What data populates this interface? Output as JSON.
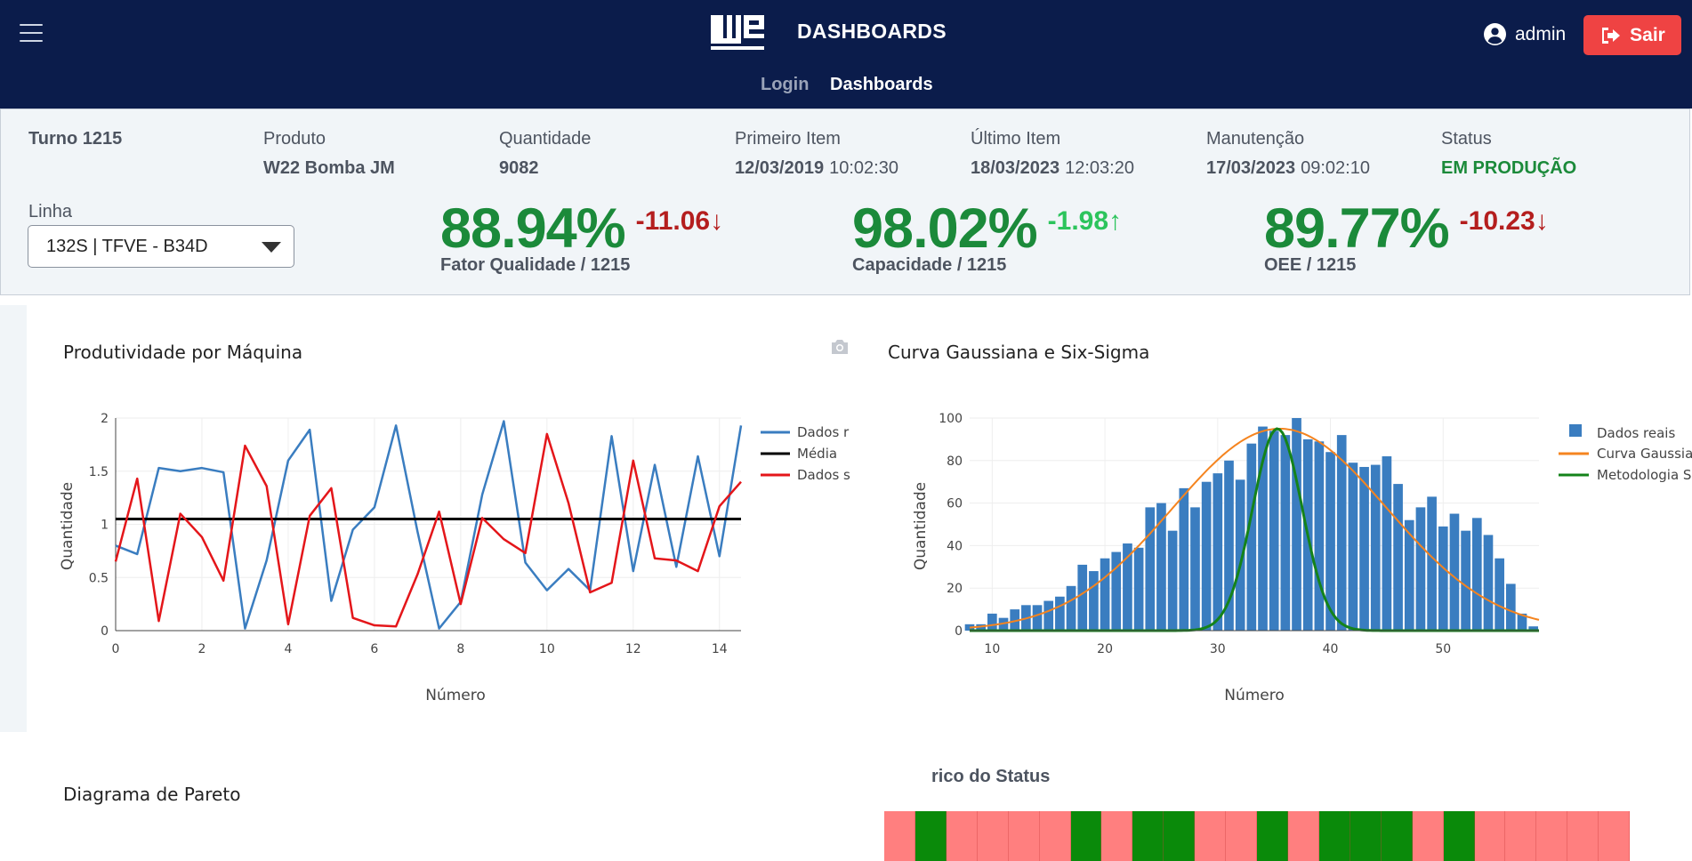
{
  "header": {
    "logo_text": "WEG",
    "title": "DASHBOARDS",
    "nav": {
      "login": "Login",
      "dashboards": "Dashboards"
    },
    "user": "admin",
    "logout": "Sair",
    "bg_color": "#0b1c4b"
  },
  "info": {
    "turno": "Turno 1215",
    "produto": {
      "label": "Produto",
      "value": "W22 Bomba JM"
    },
    "quantidade": {
      "label": "Quantidade",
      "value": "9082"
    },
    "primeiro": {
      "label": "Primeiro Item",
      "date": "12/03/2019",
      "time": "10:02:30"
    },
    "ultimo": {
      "label": "Último Item",
      "date": "18/03/2023",
      "time": "12:03:20"
    },
    "manutencao": {
      "label": "Manutenção",
      "date": "17/03/2023",
      "time": "09:02:10"
    },
    "status": {
      "label": "Status",
      "value": "EM PRODUÇÃO",
      "color": "#1b8a3a"
    },
    "linha": {
      "label": "Linha",
      "value": "132S | TFVE - B34D"
    }
  },
  "kpis": [
    {
      "value": "88.94%",
      "delta": "-11.06↓",
      "label": "Fator Qualidade / 1215",
      "trend": "down"
    },
    {
      "value": "98.02%",
      "delta": "-1.98↑",
      "label": "Capacidade / 1215",
      "trend": "up"
    },
    {
      "value": "89.77%",
      "delta": "-10.23↓",
      "label": "OEE / 1215",
      "trend": "down"
    }
  ],
  "charts": {
    "produtividade_title": "Produtividade por Máquina",
    "gauss_title": "Curva Gaussiana e Six-Sigma",
    "pareto_title": "Diagrama de Pareto",
    "status_title": "rico do Status"
  },
  "chart_data": [
    {
      "type": "line",
      "title": "Produtividade por Máquina",
      "xlabel": "Número",
      "ylabel": "Quantidade",
      "xlim": [
        0,
        14.5
      ],
      "ylim": [
        0,
        2
      ],
      "xticks": [
        0,
        2,
        4,
        6,
        8,
        10,
        12,
        14
      ],
      "yticks": [
        "0",
        "0.5",
        "1",
        "1.5",
        "2"
      ],
      "legend": "top-right",
      "series": [
        {
          "name": "Dados r",
          "color": "#3a7dc0",
          "x": [
            0,
            0.5,
            1,
            1.5,
            2,
            2.5,
            3,
            3.5,
            4,
            4.5,
            5,
            5.5,
            6,
            6.5,
            7,
            7.5,
            8,
            8.5,
            9,
            9.5,
            10,
            10.5,
            11,
            11.5,
            12,
            12.5,
            13,
            13.5,
            14,
            14.5
          ],
          "y": [
            0.8,
            0.72,
            1.53,
            1.5,
            1.53,
            1.49,
            0.02,
            0.66,
            1.6,
            1.89,
            0.28,
            0.95,
            1.16,
            1.93,
            0.93,
            0.02,
            0.27,
            1.28,
            1.97,
            0.64,
            0.38,
            0.58,
            0.38,
            1.83,
            0.56,
            1.56,
            0.6,
            1.64,
            0.7,
            1.93
          ]
        },
        {
          "name": "Média",
          "color": "#000000",
          "x": [
            0,
            14.5
          ],
          "y": [
            1.05,
            1.05
          ]
        },
        {
          "name": "Dados s",
          "color": "#e4161a",
          "x": [
            0,
            0.5,
            1,
            1.5,
            2,
            2.5,
            3,
            3.5,
            4,
            4.5,
            5,
            5.5,
            6,
            6.5,
            7,
            7.5,
            8,
            8.5,
            9,
            9.5,
            10,
            10.5,
            11,
            11.5,
            12,
            12.5,
            13,
            13.5,
            14,
            14.5
          ],
          "y": [
            0.65,
            1.43,
            0.09,
            1.1,
            0.88,
            0.47,
            1.74,
            1.36,
            0.06,
            1.08,
            1.34,
            0.12,
            0.05,
            0.04,
            0.53,
            1.12,
            0.25,
            1.06,
            0.86,
            0.73,
            1.85,
            1.2,
            0.36,
            0.45,
            1.6,
            0.68,
            0.66,
            0.56,
            1.17,
            1.4
          ]
        }
      ]
    },
    {
      "type": "bar",
      "title": "Curva Gaussiana e Six-Sigma",
      "xlabel": "Número",
      "ylabel": "Quantidade",
      "xlim": [
        8,
        58.5
      ],
      "ylim": [
        0,
        100
      ],
      "xticks": [
        10,
        20,
        30,
        40,
        50
      ],
      "yticks": [
        0,
        20,
        40,
        60,
        80,
        100
      ],
      "legend": "top-right",
      "series": [
        {
          "name": "Dados reais",
          "color": "#3a7dc0",
          "x": [
            8,
            9,
            10,
            11,
            12,
            13,
            14,
            15,
            16,
            17,
            18,
            19,
            20,
            21,
            22,
            23,
            24,
            25,
            26,
            27,
            28,
            29,
            30,
            31,
            32,
            33,
            34,
            35,
            36,
            37,
            38,
            39,
            40,
            41,
            42,
            43,
            44,
            45,
            46,
            47,
            48,
            49,
            50,
            51,
            52,
            53,
            54,
            55,
            56,
            57,
            58
          ],
          "values": [
            3,
            3,
            8,
            6,
            10,
            12,
            12,
            14,
            16,
            21,
            31,
            28,
            34,
            37,
            41,
            39,
            58,
            60,
            47,
            67,
            58,
            70,
            74,
            80,
            71,
            88,
            96,
            94,
            92,
            100,
            90,
            89,
            84,
            92,
            79,
            77,
            78,
            82,
            69,
            52,
            58,
            63,
            49,
            55,
            47,
            53,
            45,
            34,
            22,
            8,
            2
          ]
        },
        {
          "name": "Curva Gaussiana",
          "color": "#f5841f",
          "mu": 35.5,
          "sigma": 9.5,
          "peak": 95
        },
        {
          "name": "Metodologia Six-S",
          "color": "#14831a",
          "mu": 35.3,
          "sigma": 2.2,
          "peak": 95
        }
      ]
    }
  ],
  "status_strip": [
    "r",
    "g",
    "r",
    "r",
    "r",
    "r",
    "g",
    "r",
    "g",
    "g",
    "r",
    "r",
    "g",
    "r",
    "g",
    "g",
    "g",
    "r",
    "g",
    "r",
    "r",
    "r",
    "r",
    "r"
  ]
}
